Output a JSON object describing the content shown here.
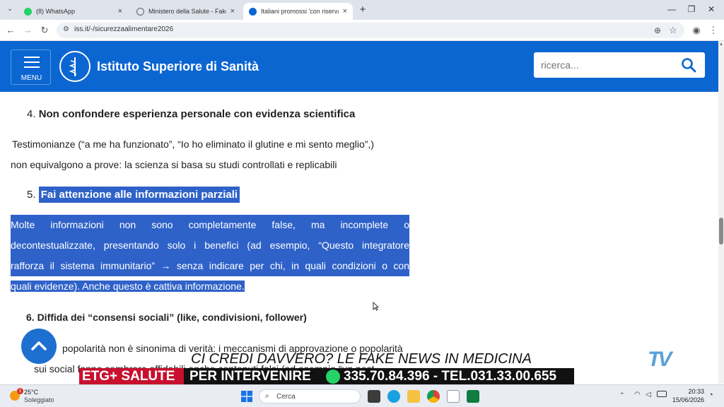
{
  "browser": {
    "tabs": [
      {
        "title": "(8) WhatsApp",
        "favicon_color": "#25d366"
      },
      {
        "title": "Ministero della Salute - Fake Ne",
        "favicon_color": "#5f6368"
      },
      {
        "title": "Italiani promossi 'con riserva' s",
        "favicon_color": "#0b66d1"
      }
    ],
    "url": "iss.it/-/sicurezzaalimentare2026",
    "new_tab": "+",
    "window_controls": {
      "minimize": "—",
      "maximize": "❐",
      "close": "✕"
    }
  },
  "site": {
    "menu_label": "MENU",
    "name": "Istituto Superiore di Sanità",
    "logo_text": "ISTITUTO SUPERIORE DI SANITÀ",
    "search_placeholder": "ricerca...",
    "brand_color": "#0b66d1"
  },
  "article": {
    "item4_number": "4.",
    "item4_title": "Non confondere esperienza personale con evidenza scientifica",
    "item4_line1": "Testimonianze (“a me ha funzionato”, “Io ho eliminato il glutine e mi sento meglio”,)",
    "item4_line2": "non equivalgono a prove: la scienza si basa su studi controllati e replicabili",
    "item5_number": "5.",
    "item5_title": "Fai attenzione alle informazioni parziali",
    "item5_lines": [
      "Molte informazioni non sono completamente false, ma incomplete o",
      "decontestualizzate, presentando solo i benefici (ad esempio, “Questo integratore",
      "rafforza il sistema immunitario” → senza indicare per chi, in quali condizioni o con",
      "quali evidenze). Anche questo è cattiva informazione."
    ],
    "item6_title": "6. Diffida dei “consensi sociali” (like, condivisioni, follower)",
    "item6_line1": "popolarità non è sinonima di verità: i meccanismi di approvazione o popolarità",
    "item6_line2": "sui social fanno sembrare affidabili anche contenuti falsi (ad esempio “un post"
  },
  "overlay": {
    "headline": "CI CREDI DAVVERO? LE FAKE NEWS IN MEDICINA",
    "channel": "ETG+ SALUTE",
    "cta": "PER INTERVENIRE",
    "phone": "335.70.84.396 - TEL.031.33.00.655",
    "logo": "TV"
  },
  "taskbar": {
    "weather_badge": "1",
    "temperature": "25°C",
    "weather": "Soleggiato",
    "search_label": "Cerca",
    "time": "20:33",
    "date": "15/06/2026"
  }
}
